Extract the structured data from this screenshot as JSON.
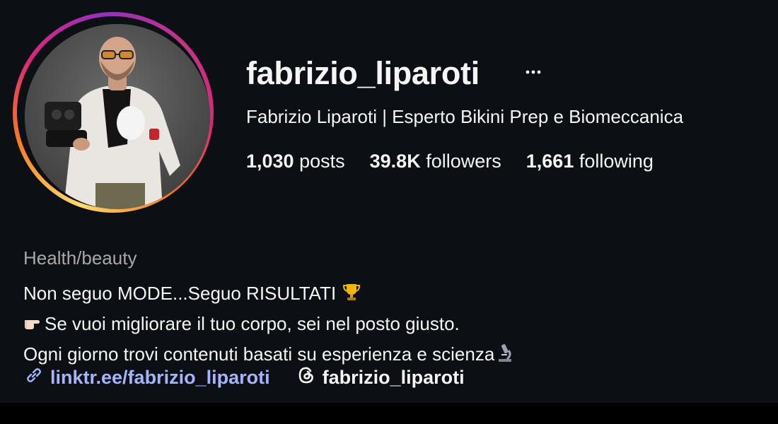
{
  "profile": {
    "username": "fabrizio_liparoti",
    "full_name": "Fabrizio Liparoti | Esperto Bikini Prep e Biomeccanica",
    "more_options_icon": "ellipsis-icon"
  },
  "stats": {
    "posts_count": "1,030",
    "posts_label": "posts",
    "followers_count": "39.8K",
    "followers_label": "followers",
    "following_count": "1,661",
    "following_label": "following"
  },
  "bio": {
    "category": "Health/beauty",
    "line1": "Non seguo MODE...Seguo RISULTATI ",
    "line2": "Se vuoi migliorare il tuo corpo, sei nel posto giusto.",
    "line3": "Ogni giorno trovi contenuti basati su esperienza e scienza",
    "line1_emoji": "trophy-icon",
    "line2_emoji": "pointing-hand-icon",
    "line3_emoji": "microscope-icon"
  },
  "links": {
    "website": "linktr.ee/fabrizio_liparoti",
    "website_icon": "link-icon",
    "threads_handle": "fabrizio_liparoti",
    "threads_icon": "threads-icon"
  },
  "colors": {
    "background": "#0c1014",
    "text": "#f5f5f5",
    "muted_text": "#a8a8a8",
    "link": "#a5b4fc",
    "story_ring": [
      "#feda75",
      "#fa7e1e",
      "#d62976",
      "#962fbf"
    ]
  }
}
